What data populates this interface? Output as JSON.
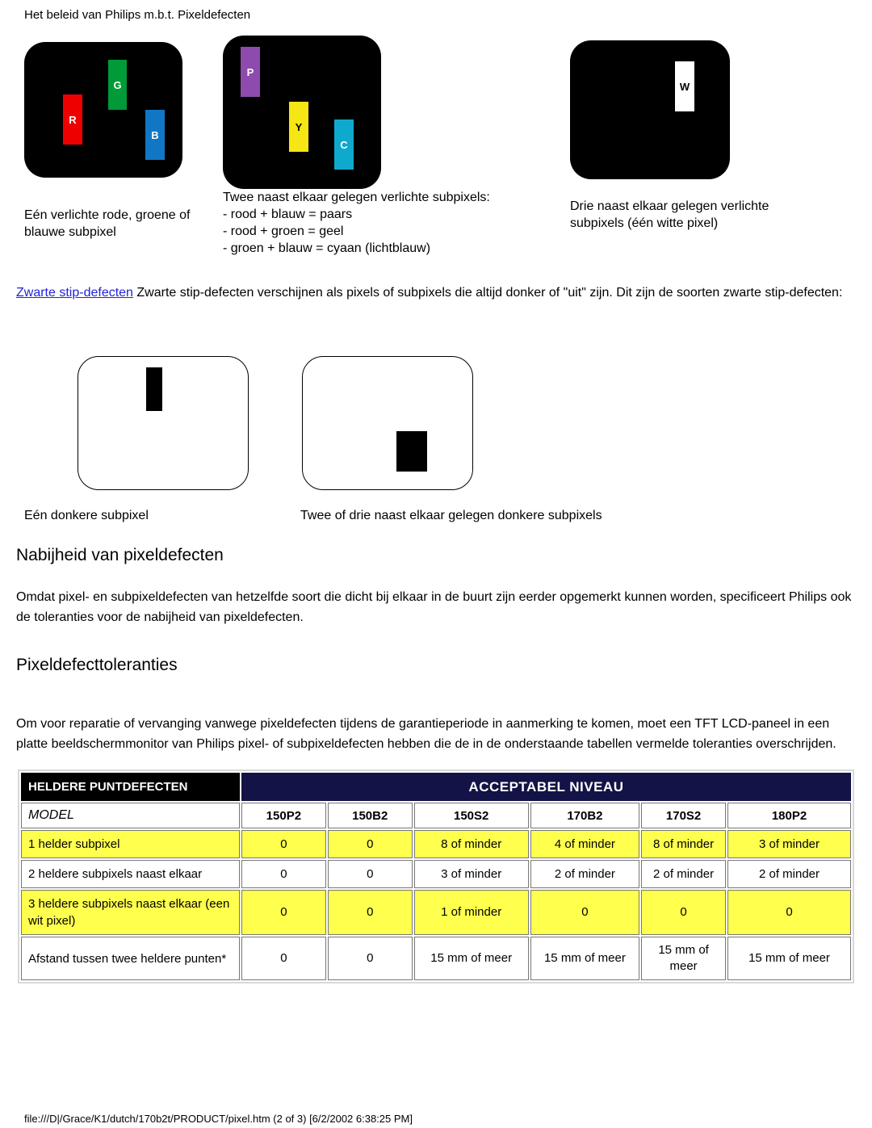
{
  "document": {
    "title": "Het beleid van Philips m.b.t. Pixeldefecten",
    "footer": "file:///D|/Grace/K1/dutch/170b2t/PRODUCT/pixel.htm (2 of 3) [6/2/2002 6:38:25 PM]"
  },
  "bright_panels": {
    "panel1": {
      "subpixels": [
        {
          "label": "R",
          "color": "#ee0000"
        },
        {
          "label": "G",
          "color": "#009a38"
        },
        {
          "label": "B",
          "color": "#1177c4"
        }
      ],
      "caption": "Eén verlichte rode, groene of blauwe subpixel"
    },
    "panel2": {
      "subpixels": [
        {
          "label": "P",
          "color": "#8e4bad"
        },
        {
          "label": "Y",
          "color": "#f5e614"
        },
        {
          "label": "C",
          "color": "#0fa9cd"
        }
      ],
      "caption_lead": "Twee naast elkaar gelegen verlichte subpixels:",
      "caption_lines": [
        "- rood + blauw = paars",
        "- rood + groen = geel",
        "- groen + blauw = cyaan (lichtblauw)"
      ]
    },
    "panel3": {
      "subpixels": [
        {
          "label": "W",
          "color": "#ffffff"
        }
      ],
      "caption": "Drie naast elkaar gelegen verlichte subpixels (één witte pixel)"
    }
  },
  "blackdot": {
    "link_text": "Zwarte stip-defecten",
    "paragraph": " Zwarte stip-defecten verschijnen als pixels of subpixels die altijd donker of \"uit\" zijn. Dit zijn de soorten zwarte stip-defecten:",
    "caption1": "Eén donkere subpixel",
    "caption2": "Twee of drie naast elkaar gelegen donkere subpixels"
  },
  "sections": {
    "nabijheid": {
      "heading": "Nabijheid van pixeldefecten",
      "paragraph": "Omdat pixel- en subpixeldefecten van hetzelfde soort die dicht bij elkaar in de buurt zijn eerder opgemerkt kunnen worden, specificeert Philips ook de toleranties voor de nabijheid van pixeldefecten."
    },
    "toleranties": {
      "heading": "Pixeldefecttoleranties",
      "paragraph": "Om voor reparatie of vervanging vanwege pixeldefecten tijdens de garantieperiode in aanmerking te komen, moet een TFT LCD-paneel in een platte beeldschermmonitor van Philips pixel- of subpixeldefecten hebben die de in de onderstaande tabellen vermelde toleranties overschrijden."
    }
  },
  "table": {
    "header_left": "HELDERE PUNTDEFECTEN",
    "header_right": "ACCEPTABEL NIVEAU",
    "model_label": "MODEL",
    "models": [
      "150P2",
      "150B2",
      "150S2",
      "170B2",
      "170S2",
      "180P2"
    ],
    "rows": [
      {
        "label": "1 helder subpixel",
        "highlight": true,
        "values": [
          "0",
          "0",
          "8 of minder",
          "4 of minder",
          "8 of minder",
          "3 of minder"
        ]
      },
      {
        "label": "2 heldere subpixels naast elkaar",
        "highlight": false,
        "values": [
          "0",
          "0",
          "3 of minder",
          "2 of minder",
          "2 of minder",
          "2 of minder"
        ]
      },
      {
        "label": "3 heldere subpixels naast elkaar (een wit pixel)",
        "highlight": true,
        "values": [
          "0",
          "0",
          "1 of minder",
          "0",
          "0",
          "0"
        ]
      },
      {
        "label": "Afstand tussen twee heldere punten*",
        "highlight": false,
        "values": [
          "0",
          "0",
          "15 mm of meer",
          "15 mm of meer",
          "15 mm of meer",
          "15 mm of meer"
        ]
      }
    ],
    "colors": {
      "header_black": "#000000",
      "header_navy": "#131347",
      "highlight_yellow": "#ffff4d"
    }
  }
}
